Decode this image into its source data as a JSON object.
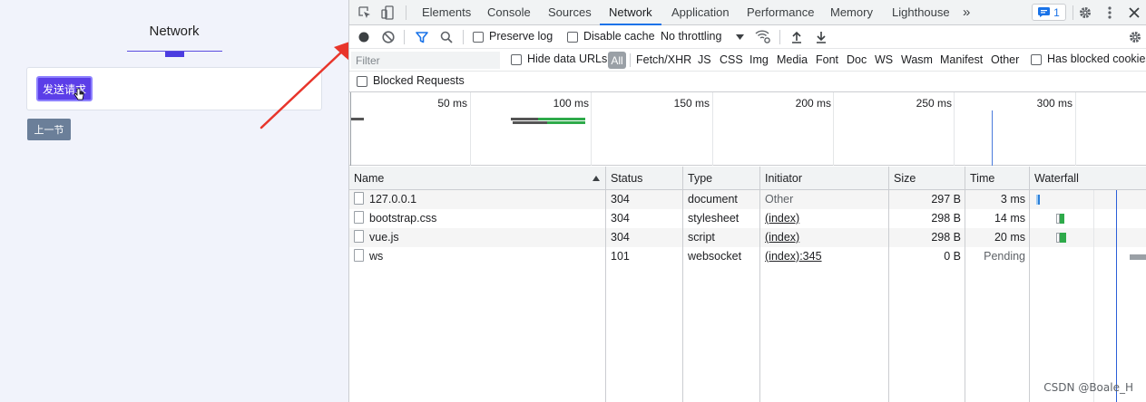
{
  "page": {
    "title": "Network",
    "send_button": "发送请求",
    "prev_button": "上一节",
    "accent": "#5b3ee8",
    "button_gray": "#6b7f99"
  },
  "devtools": {
    "tabs": [
      "Elements",
      "Console",
      "Sources",
      "Network",
      "Application",
      "Performance",
      "Memory",
      "Lighthouse"
    ],
    "active_tab": "Network",
    "more_tabs": "»",
    "issues_count": "1",
    "toolbar": {
      "preserve_log": "Preserve log",
      "disable_cache": "Disable cache",
      "throttling": "No throttling"
    },
    "filter": {
      "placeholder": "Filter",
      "hide_data_urls": "Hide data URLs",
      "all": "All",
      "types": [
        "Fetch/XHR",
        "JS",
        "CSS",
        "Img",
        "Media",
        "Font",
        "Doc",
        "WS",
        "Wasm",
        "Manifest",
        "Other"
      ],
      "has_blocked_cookies": "Has blocked cookies",
      "blocked_requests": "Blocked Requests"
    },
    "overview_ticks": [
      "50 ms",
      "100 ms",
      "150 ms",
      "200 ms",
      "250 ms",
      "300 ms"
    ],
    "columns": {
      "name": "Name",
      "status": "Status",
      "type": "Type",
      "initiator": "Initiator",
      "size": "Size",
      "time": "Time",
      "waterfall": "Waterfall"
    },
    "rows": [
      {
        "name": "127.0.0.1",
        "status": "304",
        "type": "document",
        "initiator": "Other",
        "size": "297 B",
        "time": "3 ms"
      },
      {
        "name": "bootstrap.css",
        "status": "304",
        "type": "stylesheet",
        "initiator": "(index)",
        "size": "298 B",
        "time": "14 ms"
      },
      {
        "name": "vue.js",
        "status": "304",
        "type": "script",
        "initiator": "(index)",
        "size": "298 B",
        "time": "20 ms"
      },
      {
        "name": "ws",
        "status": "101",
        "type": "websocket",
        "initiator": "(index):345",
        "size": "0 B",
        "time": "Pending"
      }
    ]
  },
  "watermark": "CSDN @Boale_H"
}
